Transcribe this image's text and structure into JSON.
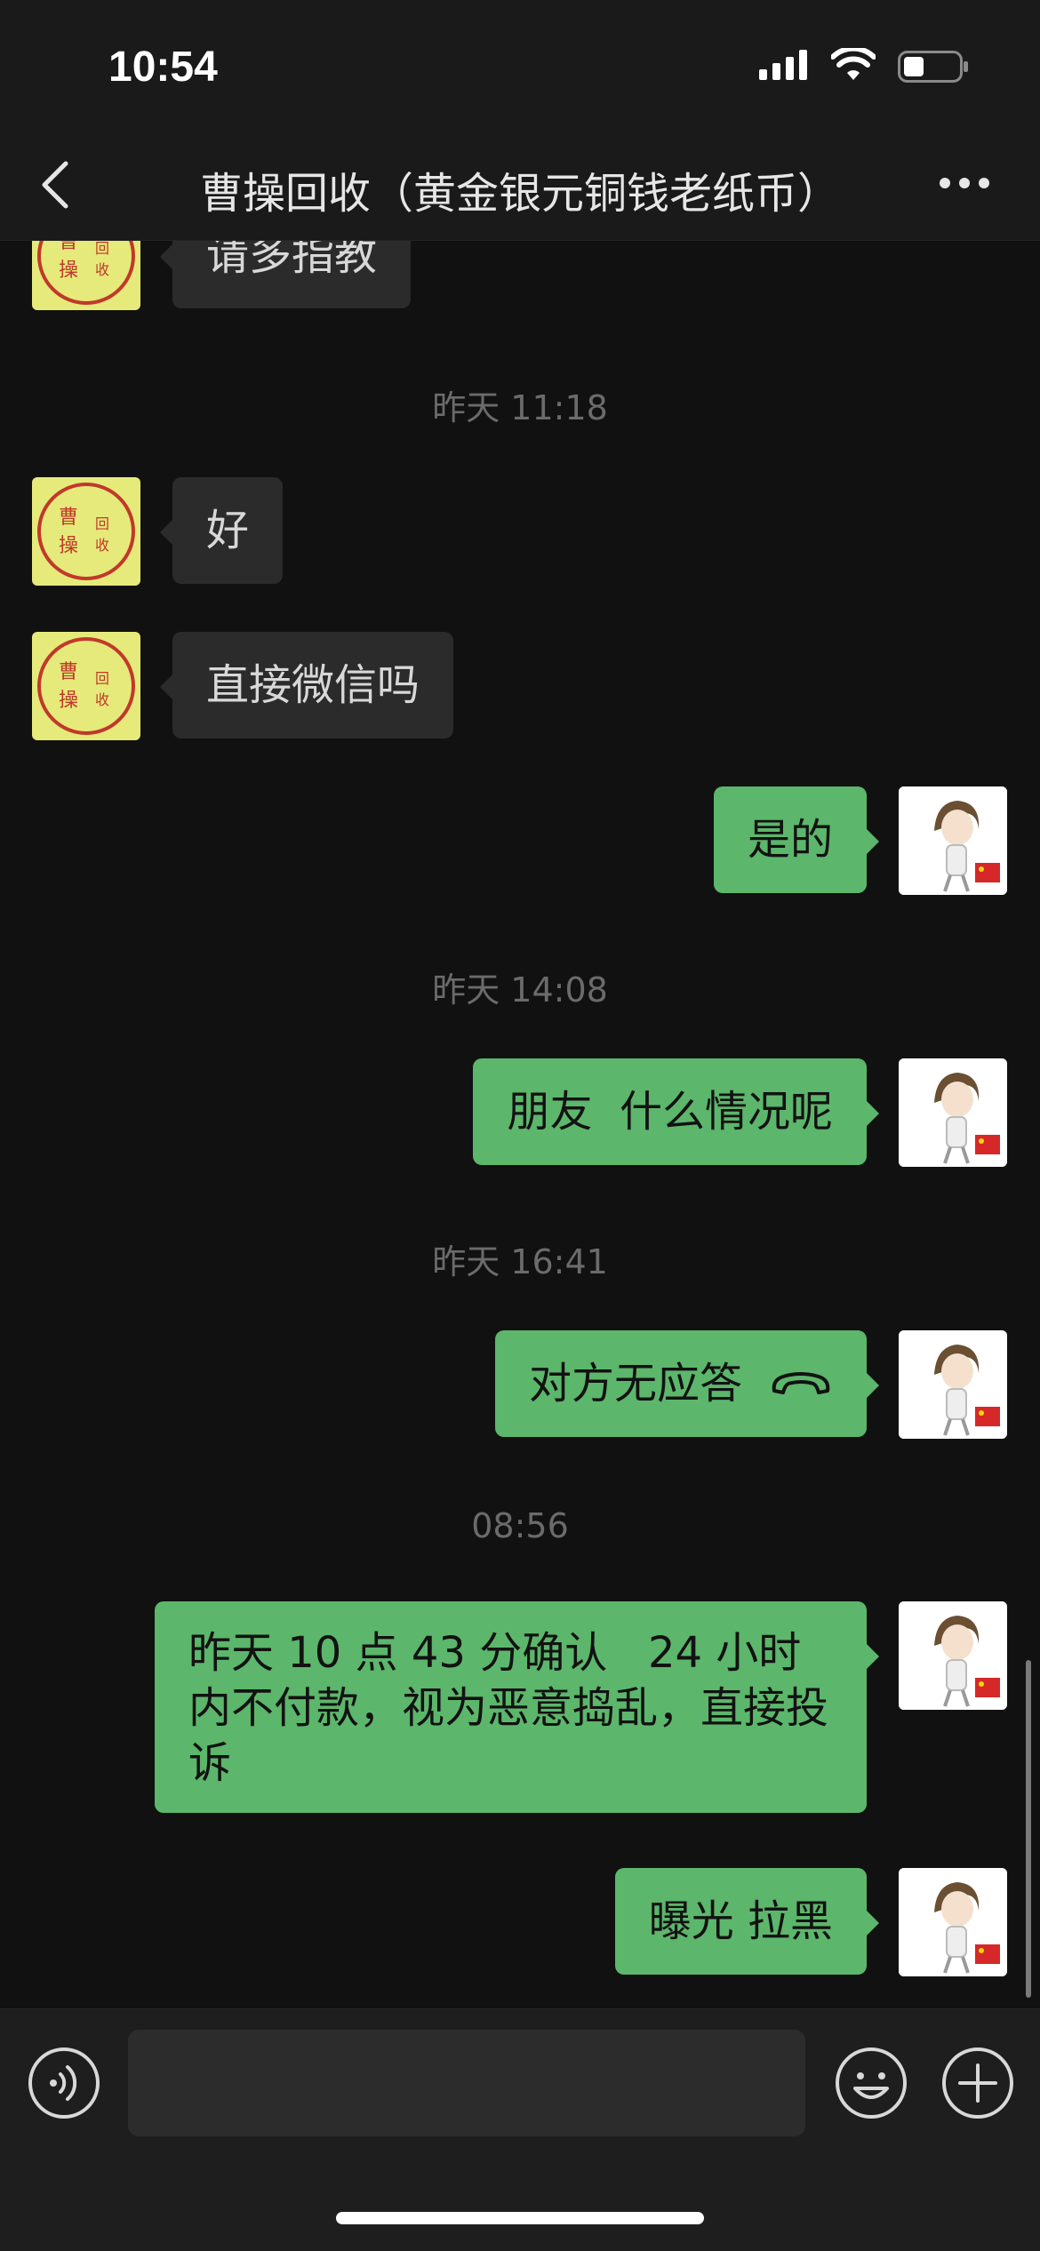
{
  "status_bar": {
    "time": "10:54"
  },
  "header": {
    "title": "曹操回收（黄金银元铜钱老纸币）"
  },
  "contact_avatar": {
    "chars": [
      "曹",
      "操",
      "回",
      "收"
    ],
    "ring_color": "#c0392b",
    "background": "#e6ea7a"
  },
  "messages": [
    {
      "type": "text",
      "side": "left",
      "text": "请多指教"
    },
    {
      "type": "timestamp",
      "text": "昨天 11:18"
    },
    {
      "type": "text",
      "side": "left",
      "text": "好"
    },
    {
      "type": "text",
      "side": "left",
      "text": "直接微信吗"
    },
    {
      "type": "text",
      "side": "right",
      "text": "是的"
    },
    {
      "type": "timestamp",
      "text": "昨天 14:08"
    },
    {
      "type": "text",
      "side": "right",
      "text": "朋友  什么情况呢"
    },
    {
      "type": "timestamp",
      "text": "昨天 16:41"
    },
    {
      "type": "call",
      "side": "right",
      "text": "对方无应答",
      "icon": "phone-hangup-icon"
    },
    {
      "type": "timestamp",
      "text": "08:56"
    },
    {
      "type": "text",
      "side": "right",
      "text": "昨天 10 点 43 分确认   24 小时内不付款，视为恶意捣乱，直接投诉"
    },
    {
      "type": "text",
      "side": "right",
      "text": "曝光 拉黑"
    }
  ],
  "input": {
    "value": "",
    "placeholder": ""
  },
  "icons": {
    "back": "chevron-left-icon",
    "more": "more-dots-icon",
    "voice": "voice-icon",
    "emoji": "emoji-icon",
    "plus": "plus-icon"
  },
  "colors": {
    "background": "#111111",
    "bubble_incoming": "#2b2b2b",
    "bubble_outgoing": "#5cb66b",
    "timestamp": "#6b6b6b"
  }
}
